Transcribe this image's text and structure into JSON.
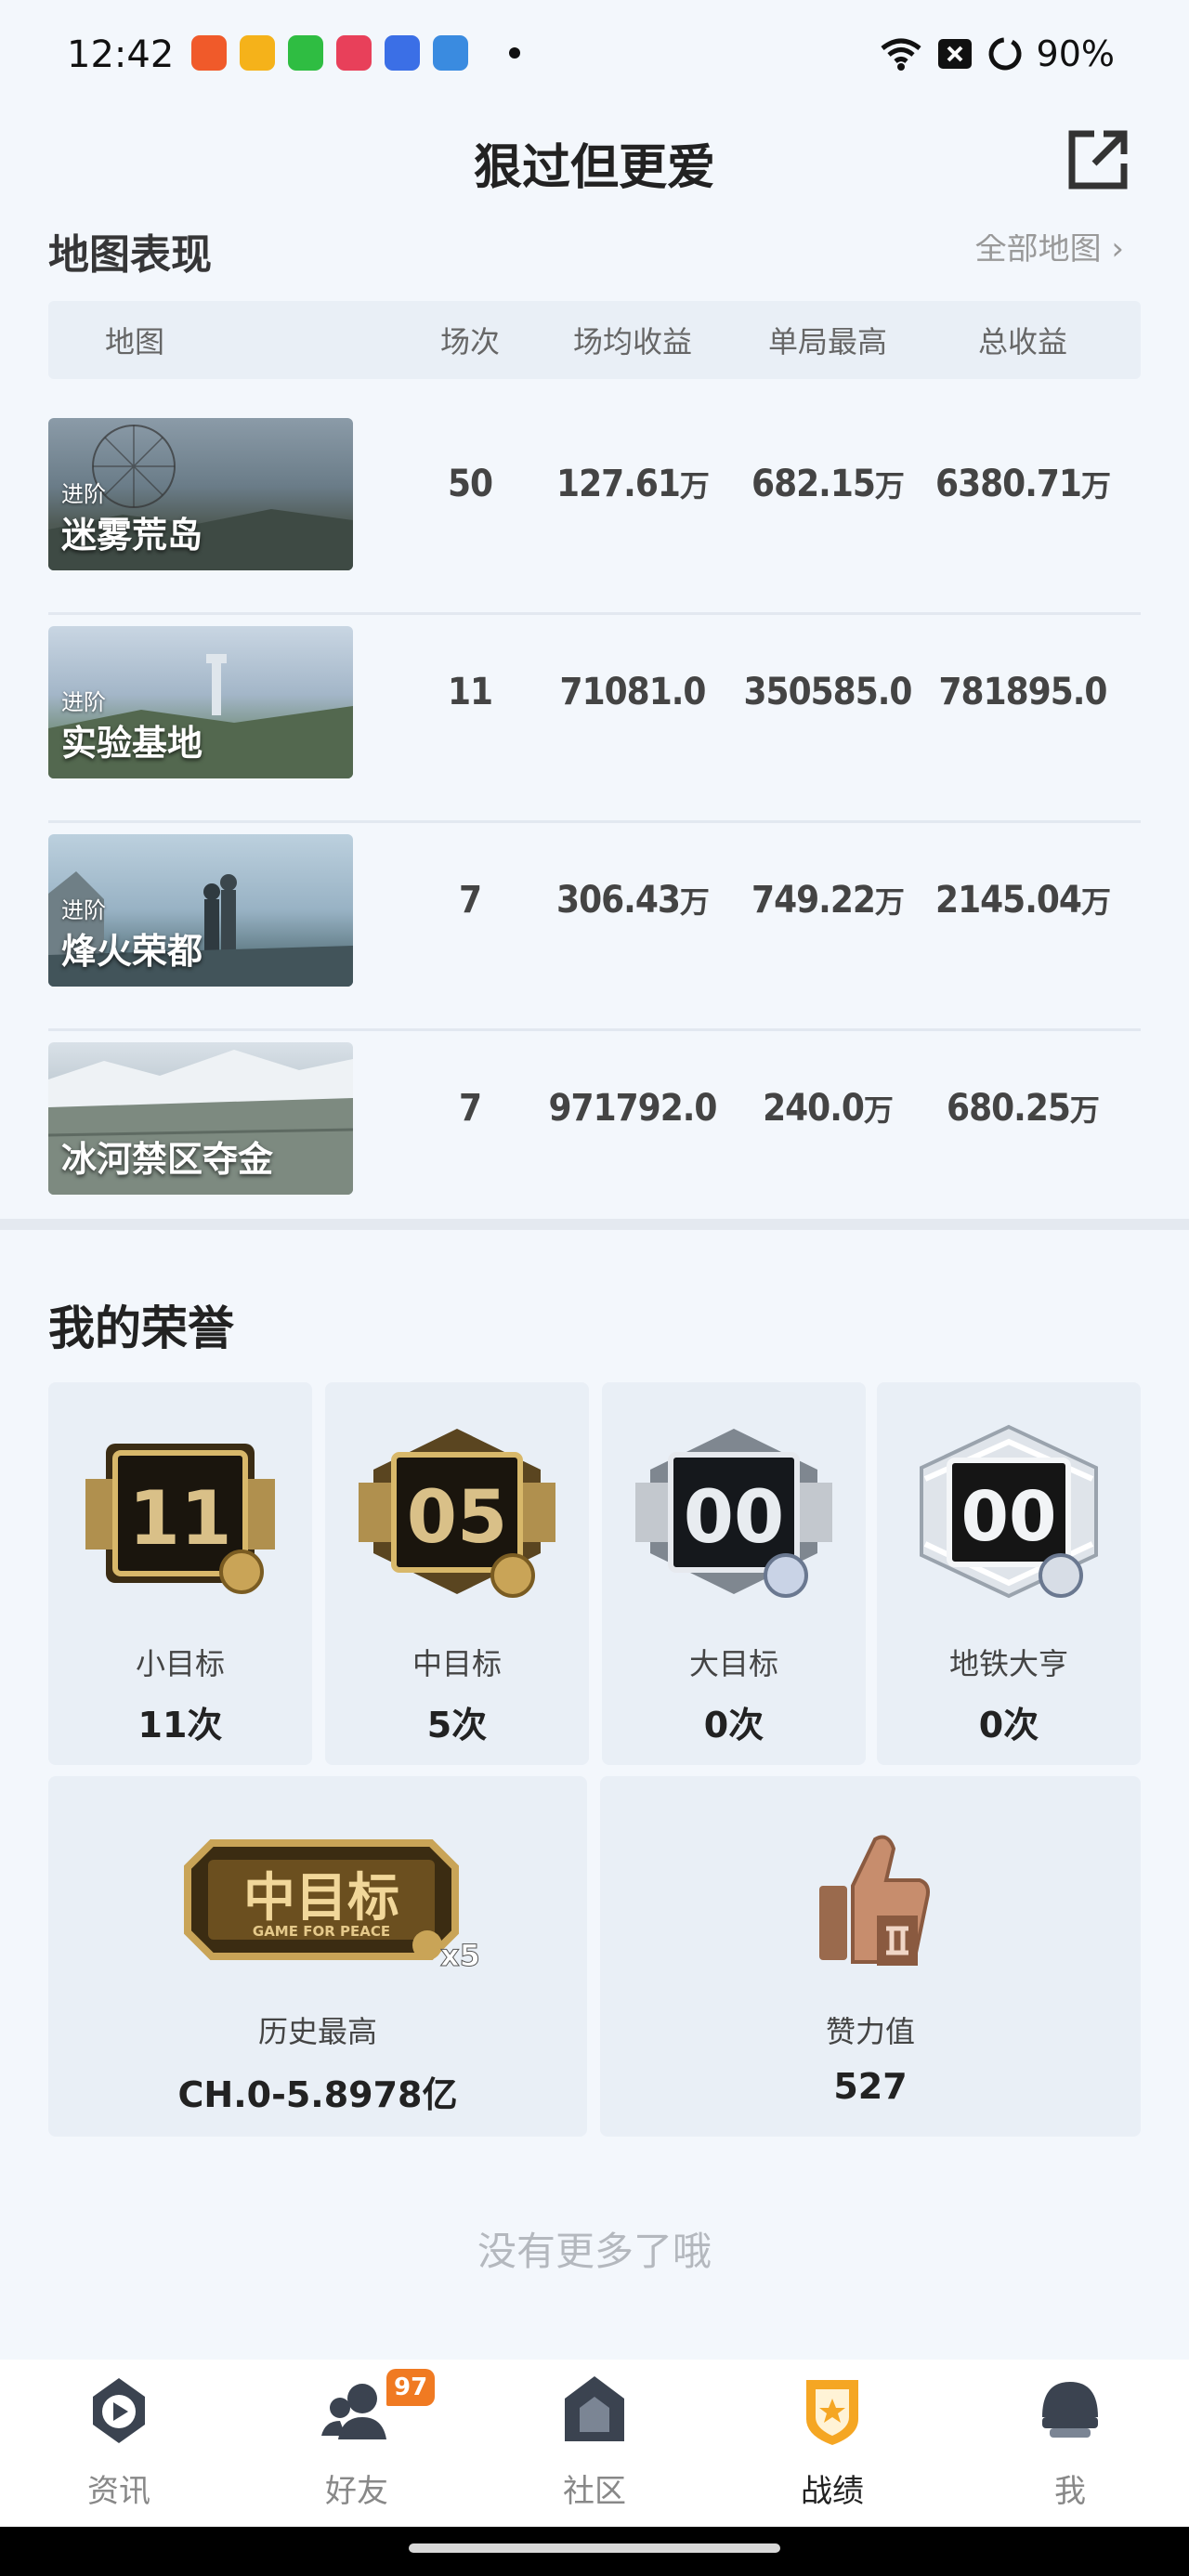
{
  "status_bar": {
    "time": "12:42",
    "battery": "90%",
    "app_icon_colors": [
      "#f05a2a",
      "#f5b21a",
      "#2fbd42",
      "#e8405a",
      "#3b6fe6",
      "#3a8be0"
    ],
    "icons": [
      "wifi-icon",
      "sim-x-icon",
      "battery-ring-icon"
    ]
  },
  "header": {
    "title": "狠过但更爱",
    "share_icon": "share-external-icon"
  },
  "map_section": {
    "title": "地图表现",
    "all_maps_link": "全部地图 ›",
    "columns": [
      "地图",
      "场次",
      "场均收益",
      "单局最高",
      "总收益"
    ],
    "rows": [
      {
        "tag": "进阶",
        "name": "迷雾荒岛",
        "games": "50",
        "avg": "127.61",
        "avg_unit": "万",
        "max": "682.15",
        "max_unit": "万",
        "total": "6380.71",
        "total_unit": "万",
        "theme": "#5d7181"
      },
      {
        "tag": "进阶",
        "name": "实验基地",
        "games": "11",
        "avg": "71081.0",
        "avg_unit": "",
        "max": "350585.0",
        "max_unit": "",
        "total": "781895.0",
        "total_unit": "",
        "theme": "#7f94a8"
      },
      {
        "tag": "进阶",
        "name": "烽火荣都",
        "games": "7",
        "avg": "306.43",
        "avg_unit": "万",
        "max": "749.22",
        "max_unit": "万",
        "total": "2145.04",
        "total_unit": "万",
        "theme": "#8aa0b0"
      },
      {
        "tag": "",
        "name": "冰河禁区夺金",
        "games": "7",
        "avg": "971792.0",
        "avg_unit": "",
        "max": "240.0",
        "max_unit": "万",
        "total": "680.25",
        "total_unit": "万",
        "theme": "#9aa6b0"
      }
    ]
  },
  "honors": {
    "title": "我的荣誉",
    "items": [
      {
        "badge_num": "11",
        "label": "小目标",
        "count": "11次",
        "style": "gold"
      },
      {
        "badge_num": "05",
        "label": "中目标",
        "count": "5次",
        "style": "gold"
      },
      {
        "badge_num": "00",
        "label": "大目标",
        "count": "0次",
        "style": "silver"
      },
      {
        "badge_num": "00",
        "label": "地铁大亨",
        "count": "0次",
        "style": "diamond"
      }
    ],
    "best": {
      "badge_text": "中目标",
      "badge_sub": "GAME FOR PEACE",
      "badge_mult": "x5",
      "label": "历史最高",
      "value": "CH.0-5.8978亿"
    },
    "likes": {
      "label": "赞力值",
      "value": "527"
    }
  },
  "footer_text": "没有更多了哦",
  "bottom_nav": {
    "items": [
      {
        "label": "资讯",
        "icon": "news-play-icon"
      },
      {
        "label": "好友",
        "icon": "friends-icon",
        "badge": "97"
      },
      {
        "label": "社区",
        "icon": "community-house-icon"
      },
      {
        "label": "战绩",
        "icon": "record-shield-icon",
        "active": true
      },
      {
        "label": "我",
        "icon": "helmet-icon"
      }
    ]
  },
  "colors": {
    "accent_orange": "#f5a623",
    "badge_orange": "#f07a22",
    "page_bg": "#f3f7fc",
    "card_bg": "#e9eff6"
  }
}
